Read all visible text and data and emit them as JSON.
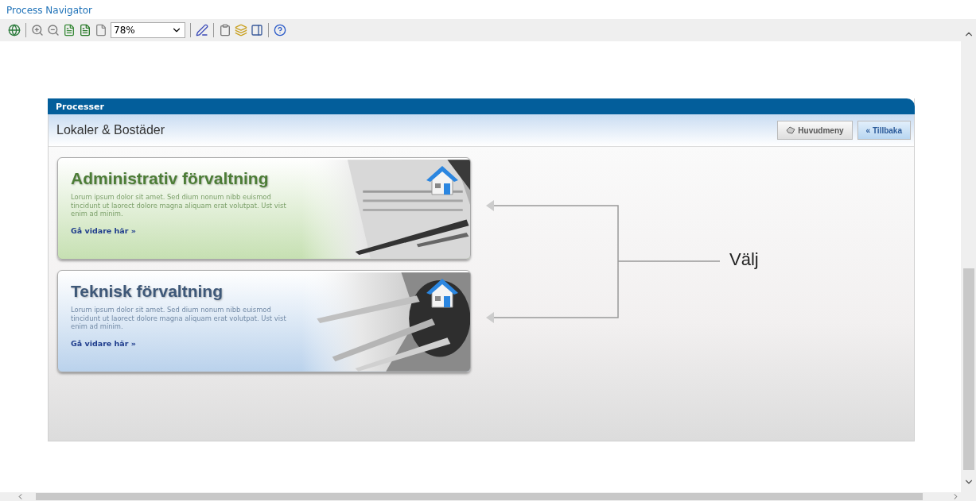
{
  "app_title": "Process Navigator",
  "toolbar": {
    "zoom": "78%"
  },
  "diagram": {
    "header": "Processer",
    "title": "Lokaler & Bostäder",
    "buttons": [
      {
        "label": "Huvudmeny",
        "kind": "menu"
      },
      {
        "label": "« Tillbaka",
        "kind": "back"
      }
    ],
    "cards": [
      {
        "kind": "green",
        "title": "Administrativ förvaltning",
        "text": "Lorum ipsum dolor sit amet. Sed dium nonum nibb euismod tincidunt ut laorect dolore magna aliquam erat volutpat. Ust vist enim ad minim.",
        "link": "Gå vidare här »"
      },
      {
        "kind": "blue",
        "title": "Teknisk förvaltning",
        "text": "Lorum ipsum dolor sit amet. Sed dium nonum nibb euismod tincidunt ut laorect dolore magna aliquam erat volutpat. Ust vist enim ad minim.",
        "link": "Gå vidare här »"
      }
    ],
    "callout": "Välj"
  }
}
